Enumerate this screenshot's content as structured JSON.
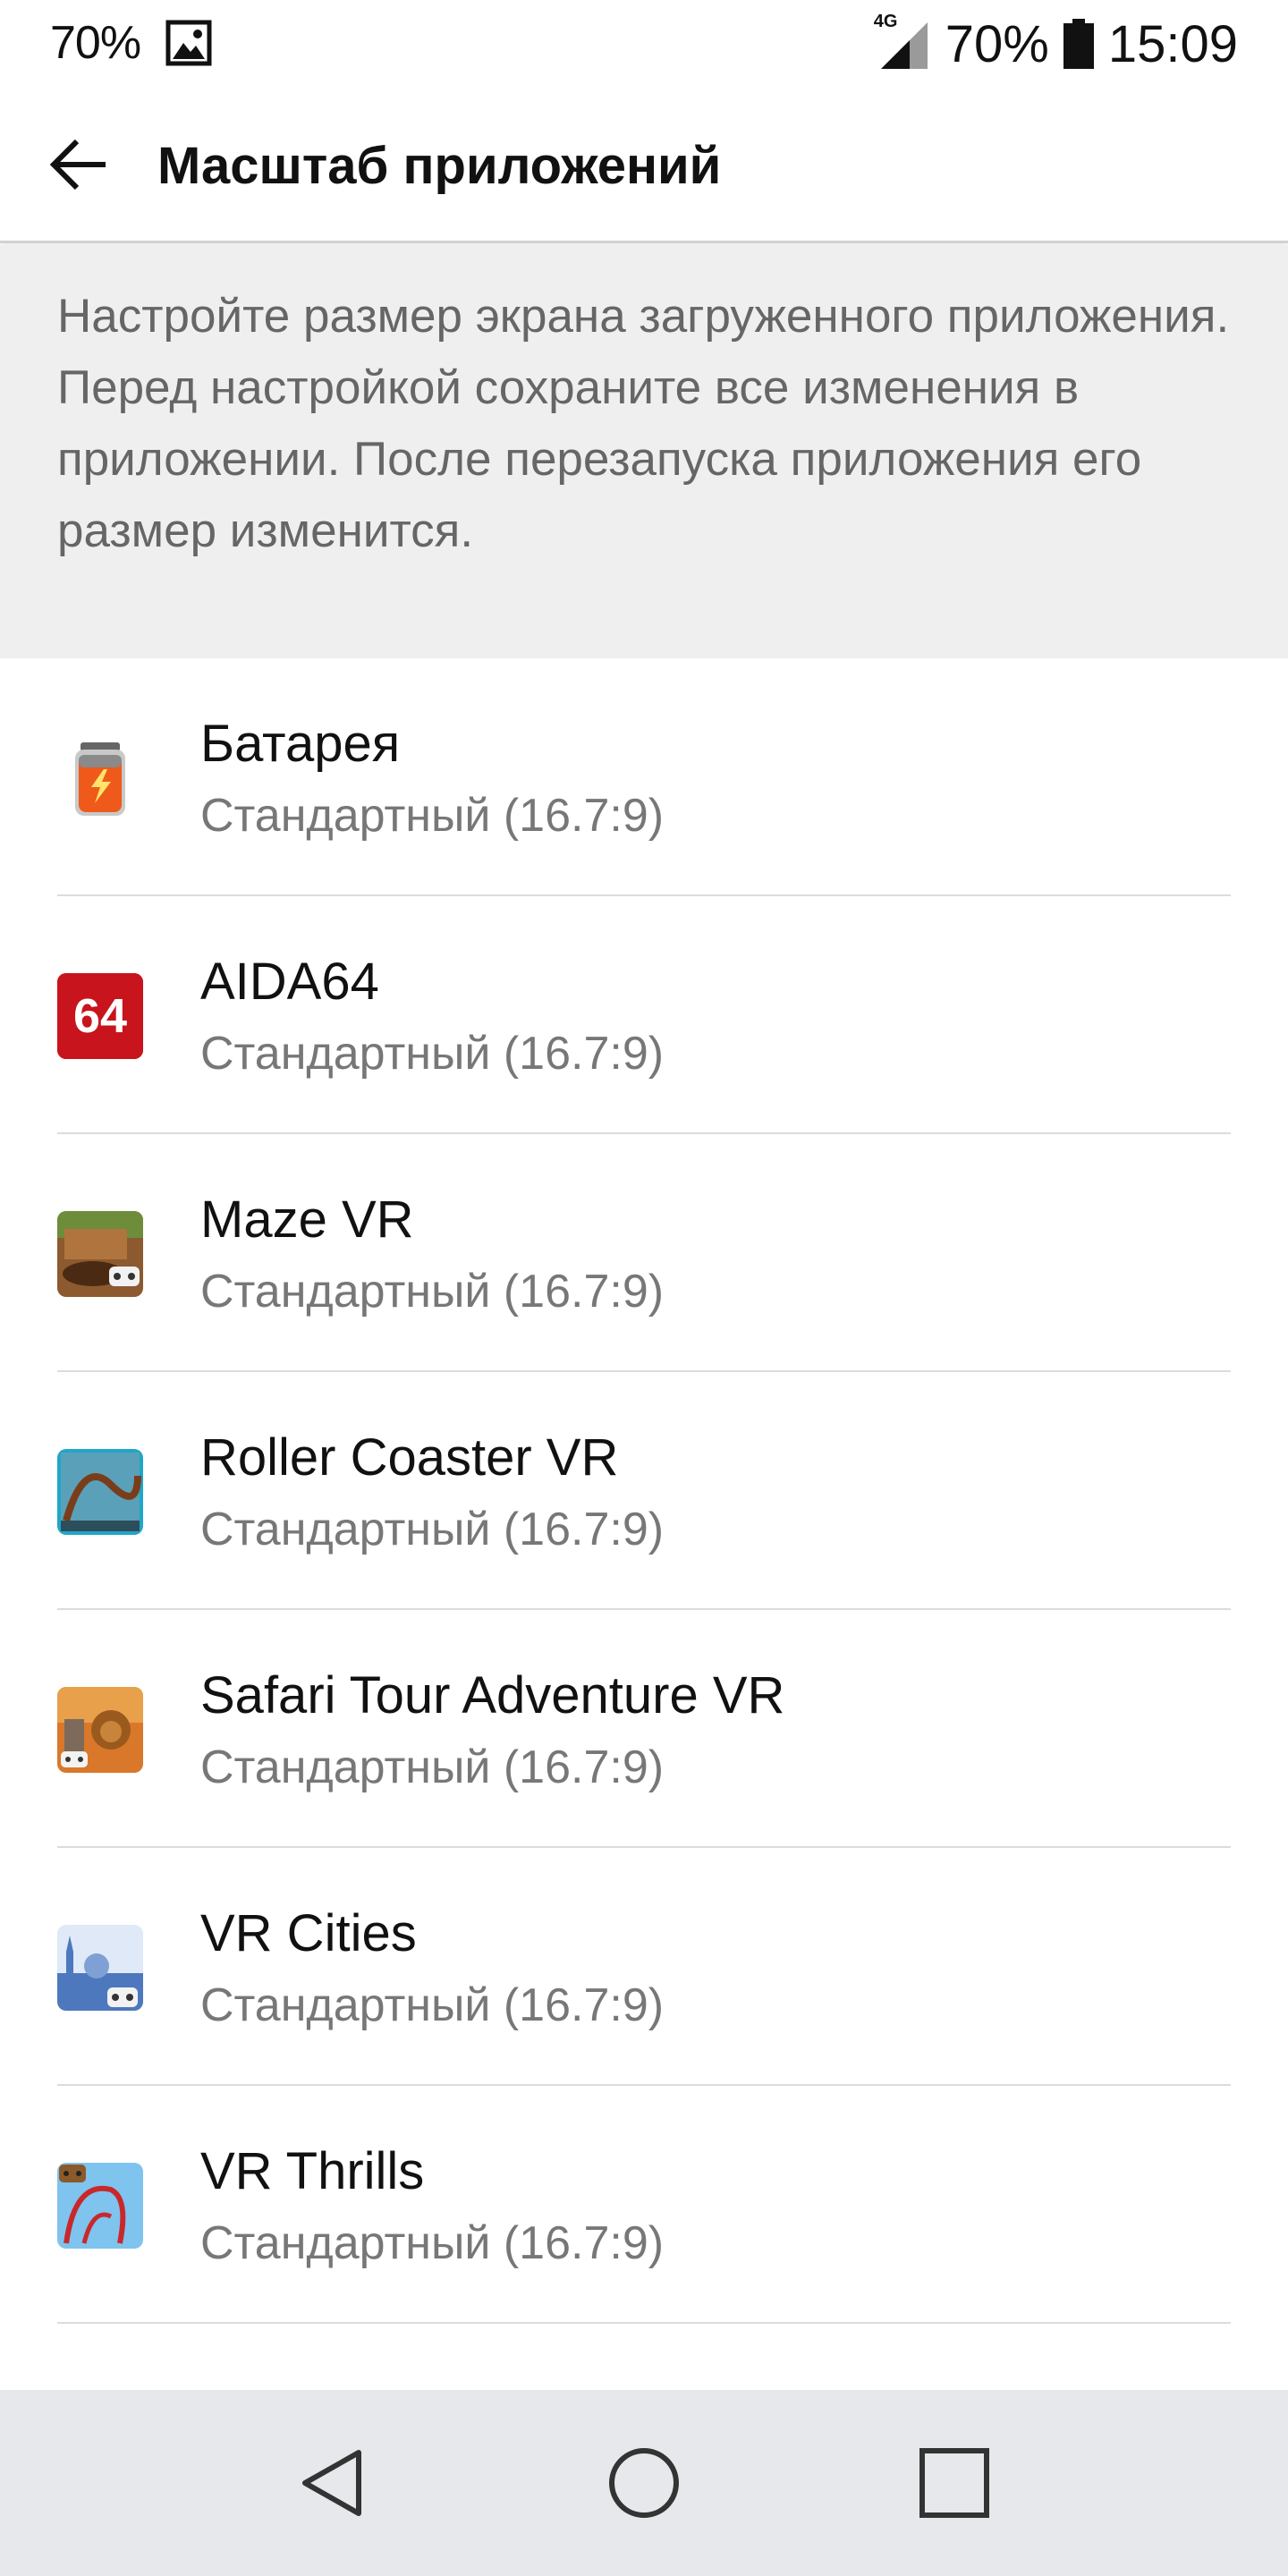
{
  "status": {
    "left_pct": "70%",
    "net_label": "4G",
    "battery_pct": "70%",
    "time": "15:09"
  },
  "header": {
    "title": "Масштаб приложений"
  },
  "description": "Настройте размер экрана загруженного приложения. Перед настройкой сохраните все изменения в приложении. После перезапуска приложения его размер изменится.",
  "apps": [
    {
      "name": "Батарея",
      "mode": "Стандартный (16.7:9)",
      "icon": "battery-app-icon"
    },
    {
      "name": "AIDA64",
      "mode": "Стандартный (16.7:9)",
      "icon": "aida64-icon"
    },
    {
      "name": "Maze VR",
      "mode": "Стандартный (16.7:9)",
      "icon": "maze-vr-icon"
    },
    {
      "name": "Roller Coaster VR",
      "mode": "Стандартный (16.7:9)",
      "icon": "roller-coaster-vr-icon"
    },
    {
      "name": "Safari Tour Adventure VR",
      "mode": "Стандартный (16.7:9)",
      "icon": "safari-tour-vr-icon"
    },
    {
      "name": "VR Cities",
      "mode": "Стандартный (16.7:9)",
      "icon": "vr-cities-icon"
    },
    {
      "name": "VR Thrills",
      "mode": "Стандартный (16.7:9)",
      "icon": "vr-thrills-icon"
    }
  ],
  "nav": {
    "back": "back-nav-icon",
    "home": "home-nav-icon",
    "recents": "recents-nav-icon"
  }
}
